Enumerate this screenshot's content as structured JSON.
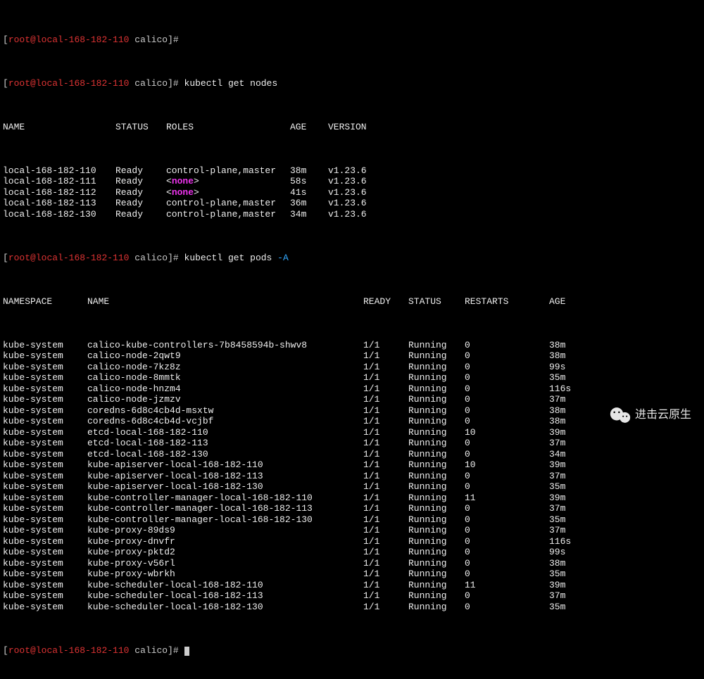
{
  "prompt": {
    "user": "root",
    "at": "@",
    "host": "local-168-182-110",
    "cwd": "calico",
    "suffix": "#"
  },
  "cmd1": "kubectl get nodes",
  "nodes_header": {
    "name": "NAME",
    "status": "STATUS",
    "roles": "ROLES",
    "age": "AGE",
    "version": "VERSION"
  },
  "nodes": [
    {
      "name": "local-168-182-110",
      "status": "Ready",
      "roles": "control-plane,master",
      "age": "38m",
      "version": "v1.23.6",
      "none": false
    },
    {
      "name": "local-168-182-111",
      "status": "Ready",
      "roles": "none",
      "age": "58s",
      "version": "v1.23.6",
      "none": true
    },
    {
      "name": "local-168-182-112",
      "status": "Ready",
      "roles": "none",
      "age": "41s",
      "version": "v1.23.6",
      "none": true
    },
    {
      "name": "local-168-182-113",
      "status": "Ready",
      "roles": "control-plane,master",
      "age": "36m",
      "version": "v1.23.6",
      "none": false
    },
    {
      "name": "local-168-182-130",
      "status": "Ready",
      "roles": "control-plane,master",
      "age": "34m",
      "version": "v1.23.6",
      "none": false
    }
  ],
  "cmd2": {
    "text": "kubectl get pods ",
    "flag": "-A"
  },
  "pods_header": {
    "ns": "NAMESPACE",
    "name": "NAME",
    "ready": "READY",
    "status": "STATUS",
    "restarts": "RESTARTS",
    "age": "AGE"
  },
  "pods": [
    {
      "ns": "kube-system",
      "name": "calico-kube-controllers-7b8458594b-shwv8",
      "ready": "1/1",
      "status": "Running",
      "restarts": "0",
      "age": "38m"
    },
    {
      "ns": "kube-system",
      "name": "calico-node-2qwt9",
      "ready": "1/1",
      "status": "Running",
      "restarts": "0",
      "age": "38m"
    },
    {
      "ns": "kube-system",
      "name": "calico-node-7kz8z",
      "ready": "1/1",
      "status": "Running",
      "restarts": "0",
      "age": "99s"
    },
    {
      "ns": "kube-system",
      "name": "calico-node-8mmtk",
      "ready": "1/1",
      "status": "Running",
      "restarts": "0",
      "age": "35m"
    },
    {
      "ns": "kube-system",
      "name": "calico-node-hnzm4",
      "ready": "1/1",
      "status": "Running",
      "restarts": "0",
      "age": "116s"
    },
    {
      "ns": "kube-system",
      "name": "calico-node-jzmzv",
      "ready": "1/1",
      "status": "Running",
      "restarts": "0",
      "age": "37m"
    },
    {
      "ns": "kube-system",
      "name": "coredns-6d8c4cb4d-msxtw",
      "ready": "1/1",
      "status": "Running",
      "restarts": "0",
      "age": "38m"
    },
    {
      "ns": "kube-system",
      "name": "coredns-6d8c4cb4d-vcjbf",
      "ready": "1/1",
      "status": "Running",
      "restarts": "0",
      "age": "38m"
    },
    {
      "ns": "kube-system",
      "name": "etcd-local-168-182-110",
      "ready": "1/1",
      "status": "Running",
      "restarts": "10",
      "age": "39m"
    },
    {
      "ns": "kube-system",
      "name": "etcd-local-168-182-113",
      "ready": "1/1",
      "status": "Running",
      "restarts": "0",
      "age": "37m"
    },
    {
      "ns": "kube-system",
      "name": "etcd-local-168-182-130",
      "ready": "1/1",
      "status": "Running",
      "restarts": "0",
      "age": "34m"
    },
    {
      "ns": "kube-system",
      "name": "kube-apiserver-local-168-182-110",
      "ready": "1/1",
      "status": "Running",
      "restarts": "10",
      "age": "39m"
    },
    {
      "ns": "kube-system",
      "name": "kube-apiserver-local-168-182-113",
      "ready": "1/1",
      "status": "Running",
      "restarts": "0",
      "age": "37m"
    },
    {
      "ns": "kube-system",
      "name": "kube-apiserver-local-168-182-130",
      "ready": "1/1",
      "status": "Running",
      "restarts": "0",
      "age": "35m"
    },
    {
      "ns": "kube-system",
      "name": "kube-controller-manager-local-168-182-110",
      "ready": "1/1",
      "status": "Running",
      "restarts": "11",
      "age": "39m"
    },
    {
      "ns": "kube-system",
      "name": "kube-controller-manager-local-168-182-113",
      "ready": "1/1",
      "status": "Running",
      "restarts": "0",
      "age": "37m"
    },
    {
      "ns": "kube-system",
      "name": "kube-controller-manager-local-168-182-130",
      "ready": "1/1",
      "status": "Running",
      "restarts": "0",
      "age": "35m"
    },
    {
      "ns": "kube-system",
      "name": "kube-proxy-89ds9",
      "ready": "1/1",
      "status": "Running",
      "restarts": "0",
      "age": "37m"
    },
    {
      "ns": "kube-system",
      "name": "kube-proxy-dnvfr",
      "ready": "1/1",
      "status": "Running",
      "restarts": "0",
      "age": "116s"
    },
    {
      "ns": "kube-system",
      "name": "kube-proxy-pktd2",
      "ready": "1/1",
      "status": "Running",
      "restarts": "0",
      "age": "99s"
    },
    {
      "ns": "kube-system",
      "name": "kube-proxy-v56rl",
      "ready": "1/1",
      "status": "Running",
      "restarts": "0",
      "age": "38m"
    },
    {
      "ns": "kube-system",
      "name": "kube-proxy-wbrkh",
      "ready": "1/1",
      "status": "Running",
      "restarts": "0",
      "age": "35m"
    },
    {
      "ns": "kube-system",
      "name": "kube-scheduler-local-168-182-110",
      "ready": "1/1",
      "status": "Running",
      "restarts": "11",
      "age": "39m"
    },
    {
      "ns": "kube-system",
      "name": "kube-scheduler-local-168-182-113",
      "ready": "1/1",
      "status": "Running",
      "restarts": "0",
      "age": "37m"
    },
    {
      "ns": "kube-system",
      "name": "kube-scheduler-local-168-182-130",
      "ready": "1/1",
      "status": "Running",
      "restarts": "0",
      "age": "35m"
    }
  ],
  "watermark": "进击云原生"
}
